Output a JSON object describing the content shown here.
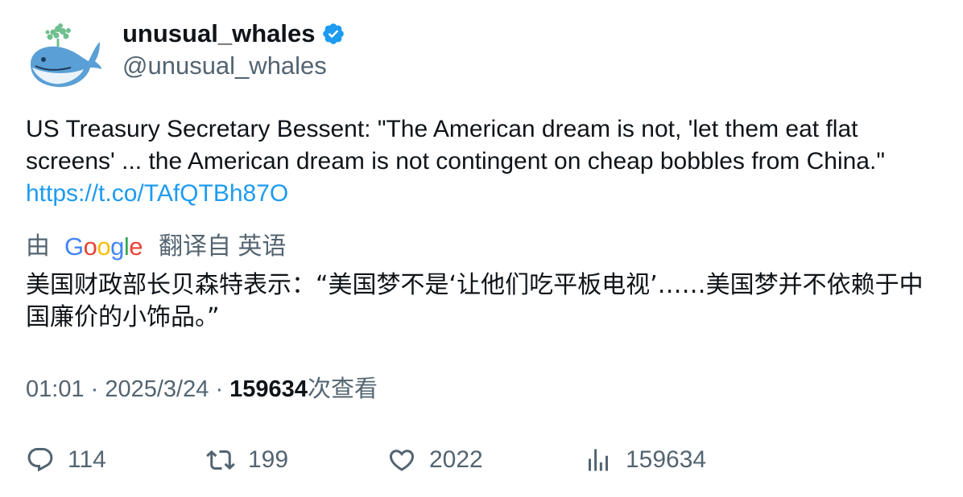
{
  "author": {
    "display_name": "unusual_whales",
    "handle": "@unusual_whales",
    "verified": true,
    "avatar_icon": "whale-avatar-icon",
    "verified_icon": "verified-badge-icon",
    "verified_color": "#1d9bf0"
  },
  "tweet": {
    "text": "US Treasury Secretary Bessent: \"The American dream is not, 'let them eat flat screens' ... the American dream is not contingent on cheap bobbles from China.\"",
    "link": "https://t.co/TAfQTBh87O",
    "link_color": "#1d9bf0"
  },
  "translation": {
    "by_label": "由",
    "provider": "Google",
    "suffix_label": "翻译自 英语",
    "text": "美国财政部长贝森特表示：“美国梦不是‘让他们吃平板电视’……美国梦并不依赖于中国廉价的小饰品。”"
  },
  "meta": {
    "time": "01:01",
    "separator": "·",
    "date": "2025/3/24",
    "views_count": "159634",
    "views_label": "次查看"
  },
  "actions": {
    "reply_count": "114",
    "retweet_count": "199",
    "like_count": "2022",
    "views_count": "159634",
    "icons": [
      "reply-icon",
      "retweet-icon",
      "like-icon",
      "views-icon"
    ],
    "icon_color": "#536471"
  }
}
